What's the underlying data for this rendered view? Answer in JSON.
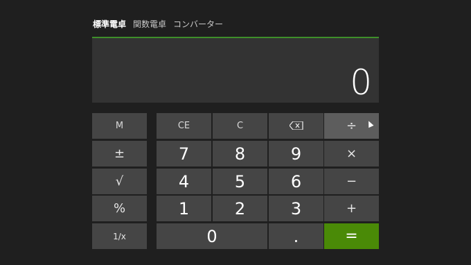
{
  "tabs": [
    "標準電卓",
    "関数電卓",
    "コンバーター"
  ],
  "display": {
    "value": "0"
  },
  "memory_buttons": [
    "M",
    "±",
    "√",
    "%",
    "1/x"
  ],
  "keys": {
    "ce": "CE",
    "c": "C",
    "backspace_icon": "backspace-icon",
    "divide": "÷",
    "multiply": "×",
    "subtract": "−",
    "add": "+",
    "equals": "=",
    "decimal": ".",
    "digits": [
      "0",
      "1",
      "2",
      "3",
      "4",
      "5",
      "6",
      "7",
      "8",
      "9"
    ]
  },
  "colors": {
    "accent": "#3f8f2a",
    "equals": "#4a8a07"
  }
}
